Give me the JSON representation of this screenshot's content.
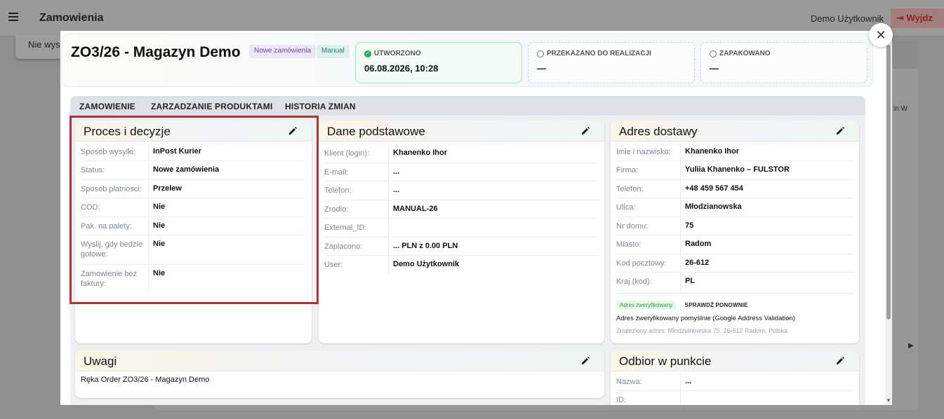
{
  "app": {
    "title": "Zamowienia",
    "user": "Demo Użytkownik",
    "logout_label": "Wyjdz",
    "bg_card_text": "Nie wysy",
    "bg_text": "ma d in W",
    "bg_pager": "›   ›|"
  },
  "header": {
    "order_title": "ZO3/26 - Magazyn Demo",
    "badge_status": "Nowe zamówienia",
    "badge_manual": "Manual",
    "steps": [
      {
        "label": "UTWORZONO",
        "value": "06.08.2026, 10:28"
      },
      {
        "label": "PRZEKAZANO DO REALIZACJI",
        "value": "—"
      },
      {
        "label": "ZAPAKOWANO",
        "value": "—"
      }
    ]
  },
  "tabs": [
    "ZAMOWIENIE",
    "ZARZADZANIE PRODUKTAMI",
    "HISTORIA ZMIAN"
  ],
  "proces": {
    "title": "Proces i decyzje",
    "rows": [
      {
        "label": "Sposob wysylki:",
        "value": "InPost Kurier"
      },
      {
        "label": "Status:",
        "value": "Nowe zamówienia"
      },
      {
        "label": "Sposob platnosci:",
        "value": "Przelew"
      },
      {
        "label": "COD:",
        "value": "Nie"
      },
      {
        "label": "Pak. na palety:",
        "value": "Nie"
      },
      {
        "label": "Wyslij, gdy bedzie gotowe:",
        "value": "Nie"
      },
      {
        "label": "Zamowienie bez faktury:",
        "value": "Nie"
      }
    ]
  },
  "dane": {
    "title": "Dane podstawowe",
    "rows": [
      {
        "label": "Klient (login):",
        "value": "Khanenko Ihor"
      },
      {
        "label": "E-mail:",
        "value": "..."
      },
      {
        "label": "Telefon:",
        "value": "..."
      },
      {
        "label": "Zrodlo:",
        "value": "MANUAL-26"
      },
      {
        "label": "External_ID:",
        "value": ""
      },
      {
        "label": "Zaplacono:",
        "value": "... PLN z 0.00 PLN"
      },
      {
        "label": "User:",
        "value": "Demo Użytkownik"
      }
    ]
  },
  "adres": {
    "title": "Adres dostawy",
    "rows": [
      {
        "label": "Imie i nazwisko:",
        "value": "Khanenko Ihor"
      },
      {
        "label": "Firma:",
        "value": "Yuliia Khanenko – FULSTOR"
      },
      {
        "label": "Telefon:",
        "value": "+48 459 567 454"
      },
      {
        "label": "Ulica:",
        "value": "Młodzianowska"
      },
      {
        "label": "Nr domu:",
        "value": "75"
      },
      {
        "label": "Miasto:",
        "value": "Radom"
      },
      {
        "label": "Kod pocztowy:",
        "value": "26-612"
      },
      {
        "label": "Kraj (kod):",
        "value": "PL"
      }
    ],
    "verified_badge": "Adres zweryfikowany",
    "recheck_label": "SPRAWDŹ PONOWNIE",
    "verified_msg": "Adres zweryfikowany pomyślnie (Google Address Validation)",
    "found_address": "Znaleziony adres: Młodzianowska 75, 26-612 Radom, Polska"
  },
  "uwagi": {
    "title": "Uwagi",
    "text": "Ręka Order ZO3/26 - Magazyn Demo"
  },
  "odbior": {
    "title": "Odbior w punkcie",
    "rows": [
      {
        "label": "Nazwa:",
        "value": "..."
      },
      {
        "label": "ID:",
        "value": ""
      }
    ]
  },
  "colors": {
    "accent_red": "#d9202a",
    "success": "#2eaa64"
  }
}
